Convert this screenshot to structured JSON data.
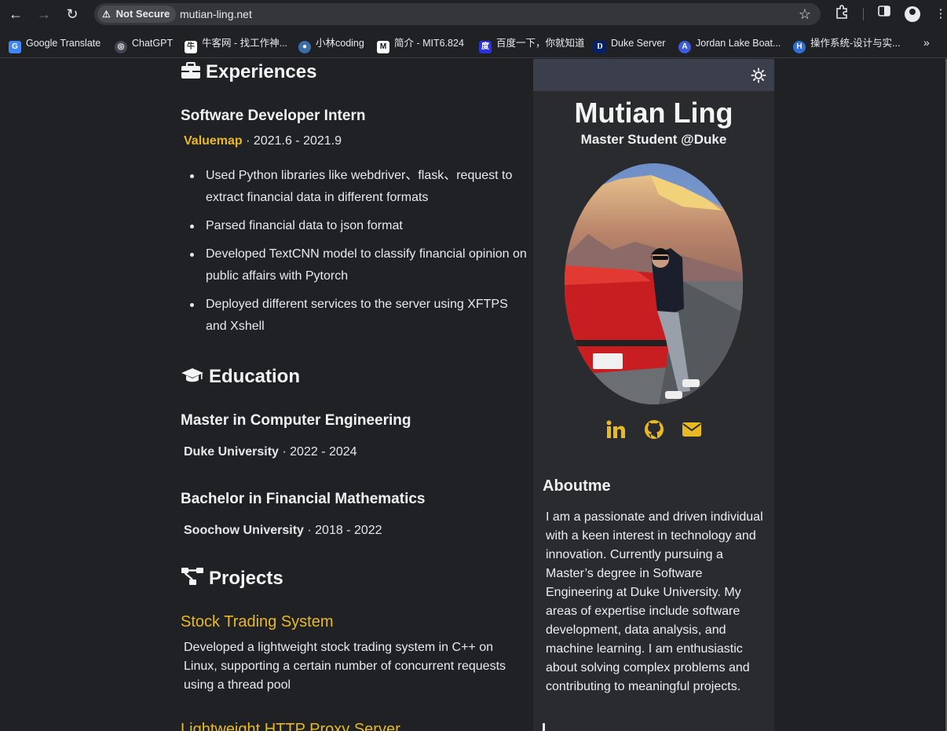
{
  "browser": {
    "security_label": "Not Secure",
    "url": "mutian-ling.net",
    "bookmarks": [
      {
        "label": "Google Translate",
        "color": "#4285f4",
        "glyph": "G"
      },
      {
        "label": "ChatGPT",
        "color": "#444654",
        "glyph": "◎"
      },
      {
        "label": "牛客网 - 找工作神...",
        "color": "#ffffff",
        "glyph": "牛"
      },
      {
        "label": "小林coding",
        "color": "#3b6ea8",
        "glyph": "●"
      },
      {
        "label": "简介 - MIT6.824",
        "color": "#ffffff",
        "glyph": "M"
      },
      {
        "label": "百度一下，你就知道",
        "color": "#2932e1",
        "glyph": "度"
      },
      {
        "label": "Duke Server",
        "color": "#012169",
        "glyph": "D"
      },
      {
        "label": "Jordan Lake Boat...",
        "color": "#3b5bdb",
        "glyph": "A"
      },
      {
        "label": "操作系统-设计与实...",
        "color": "#2f6fd6",
        "glyph": "H"
      }
    ]
  },
  "experiences": {
    "heading": "Experiences",
    "job_title": "Software Developer Intern",
    "company": "Valuemap",
    "period": " · 2021.6 - 2021.9",
    "bullets": [
      "Used Python libraries like webdriver、flask、request to extract financial data in different formats",
      "Parsed financial data to json format",
      "Developed TextCNN model to classify financial opinion on public affairs with Pytorch",
      "Deployed different services to the server using XFTPS and Xshell"
    ]
  },
  "education": {
    "heading": "Education",
    "degrees": [
      {
        "title": "Master in Computer Engineering",
        "school": "Duke University",
        "period": " · 2022 - 2024"
      },
      {
        "title": "Bachelor in Financial Mathematics",
        "school": "Soochow University",
        "period": " · 2018 - 2022"
      }
    ]
  },
  "projects": {
    "heading": "Projects",
    "items": [
      {
        "title": "Stock Trading System",
        "desc": "Developed a lightweight stock trading system in C++ on Linux, supporting a certain number of concurrent requests using a thread pool"
      },
      {
        "title": "Lightweight HTTP Proxy Server",
        "desc": ""
      }
    ]
  },
  "profile": {
    "name": "Mutian Ling",
    "subtitle": "Master Student @Duke",
    "about_heading": "Aboutme",
    "about_text": "I am a passionate and driven individual with a keen interest in technology and innovation. Currently pursuing a Master’s degree in Software Engineering at Duke University. My areas of expertise include software development, data analysis, and machine learning. I am enthusiastic about solving complex problems and contributing to meaningful projects.",
    "socials": [
      "linkedin-icon",
      "github-icon",
      "email-icon"
    ]
  },
  "theme": {
    "accent": "#e8b923",
    "page_bg": "#202124",
    "sidebar_bg": "#2a2b2e",
    "sidebar_header_bg": "#3a3f4b"
  }
}
